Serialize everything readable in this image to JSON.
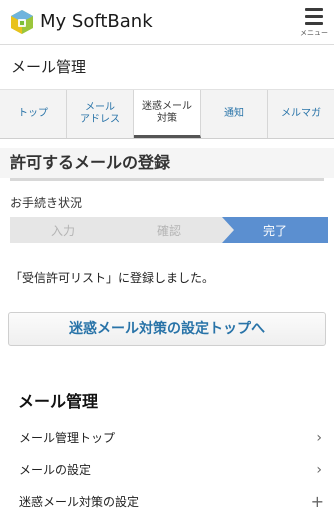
{
  "header": {
    "brand": "My SoftBank",
    "menu_label": "メニュー"
  },
  "section": {
    "title": "メール管理"
  },
  "tabs": [
    {
      "label": "トップ"
    },
    {
      "label": "メール\nアドレス"
    },
    {
      "label": "迷惑メール\n対策"
    },
    {
      "label": "通知"
    },
    {
      "label": "メルマガ"
    }
  ],
  "page": {
    "title": "許可するメールの登録"
  },
  "progress": {
    "label": "お手続き状況",
    "steps": [
      "入力",
      "確認",
      "完了"
    ],
    "current_step": 3
  },
  "message": "「受信許可リスト」に登録しました。",
  "cta": {
    "label": "迷惑メール対策の設定トップへ"
  },
  "nav": {
    "heading": "メール管理",
    "items": [
      {
        "label": "メール管理トップ"
      },
      {
        "label": "メールの設定"
      },
      {
        "label": "迷惑メール対策の設定"
      }
    ]
  },
  "colors": {
    "link": "#2873a8",
    "step_active": "#5b8fd0",
    "step_inactive": "#e6e6e6"
  }
}
